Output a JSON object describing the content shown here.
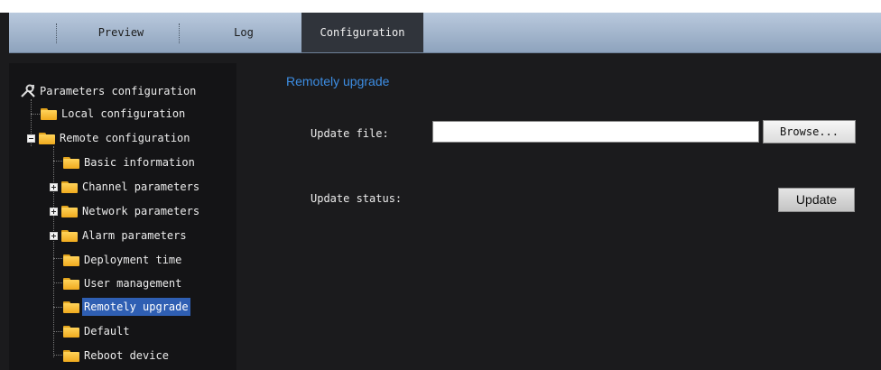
{
  "tabs": [
    {
      "label": "Preview",
      "active": false
    },
    {
      "label": "Log",
      "active": false
    },
    {
      "label": "Configuration",
      "active": true
    }
  ],
  "tree": {
    "root": "Parameters configuration",
    "items": [
      "Local configuration",
      "Remote configuration",
      "Basic information",
      "Channel parameters",
      "Network parameters",
      "Alarm parameters",
      "Deployment time",
      "User management",
      "Remotely upgrade",
      "Default",
      "Reboot device"
    ],
    "selected": "Remotely upgrade"
  },
  "main": {
    "title": "Remotely upgrade",
    "update_file_label": "Update file:",
    "update_file_value": "",
    "browse_label": "Browse...",
    "update_status_label": "Update status:",
    "update_status_value": "",
    "update_label": "Update"
  },
  "colors": {
    "accent": "#3d8ee4",
    "selection": "#2f5fb3",
    "folder": "#f0aa1e"
  }
}
